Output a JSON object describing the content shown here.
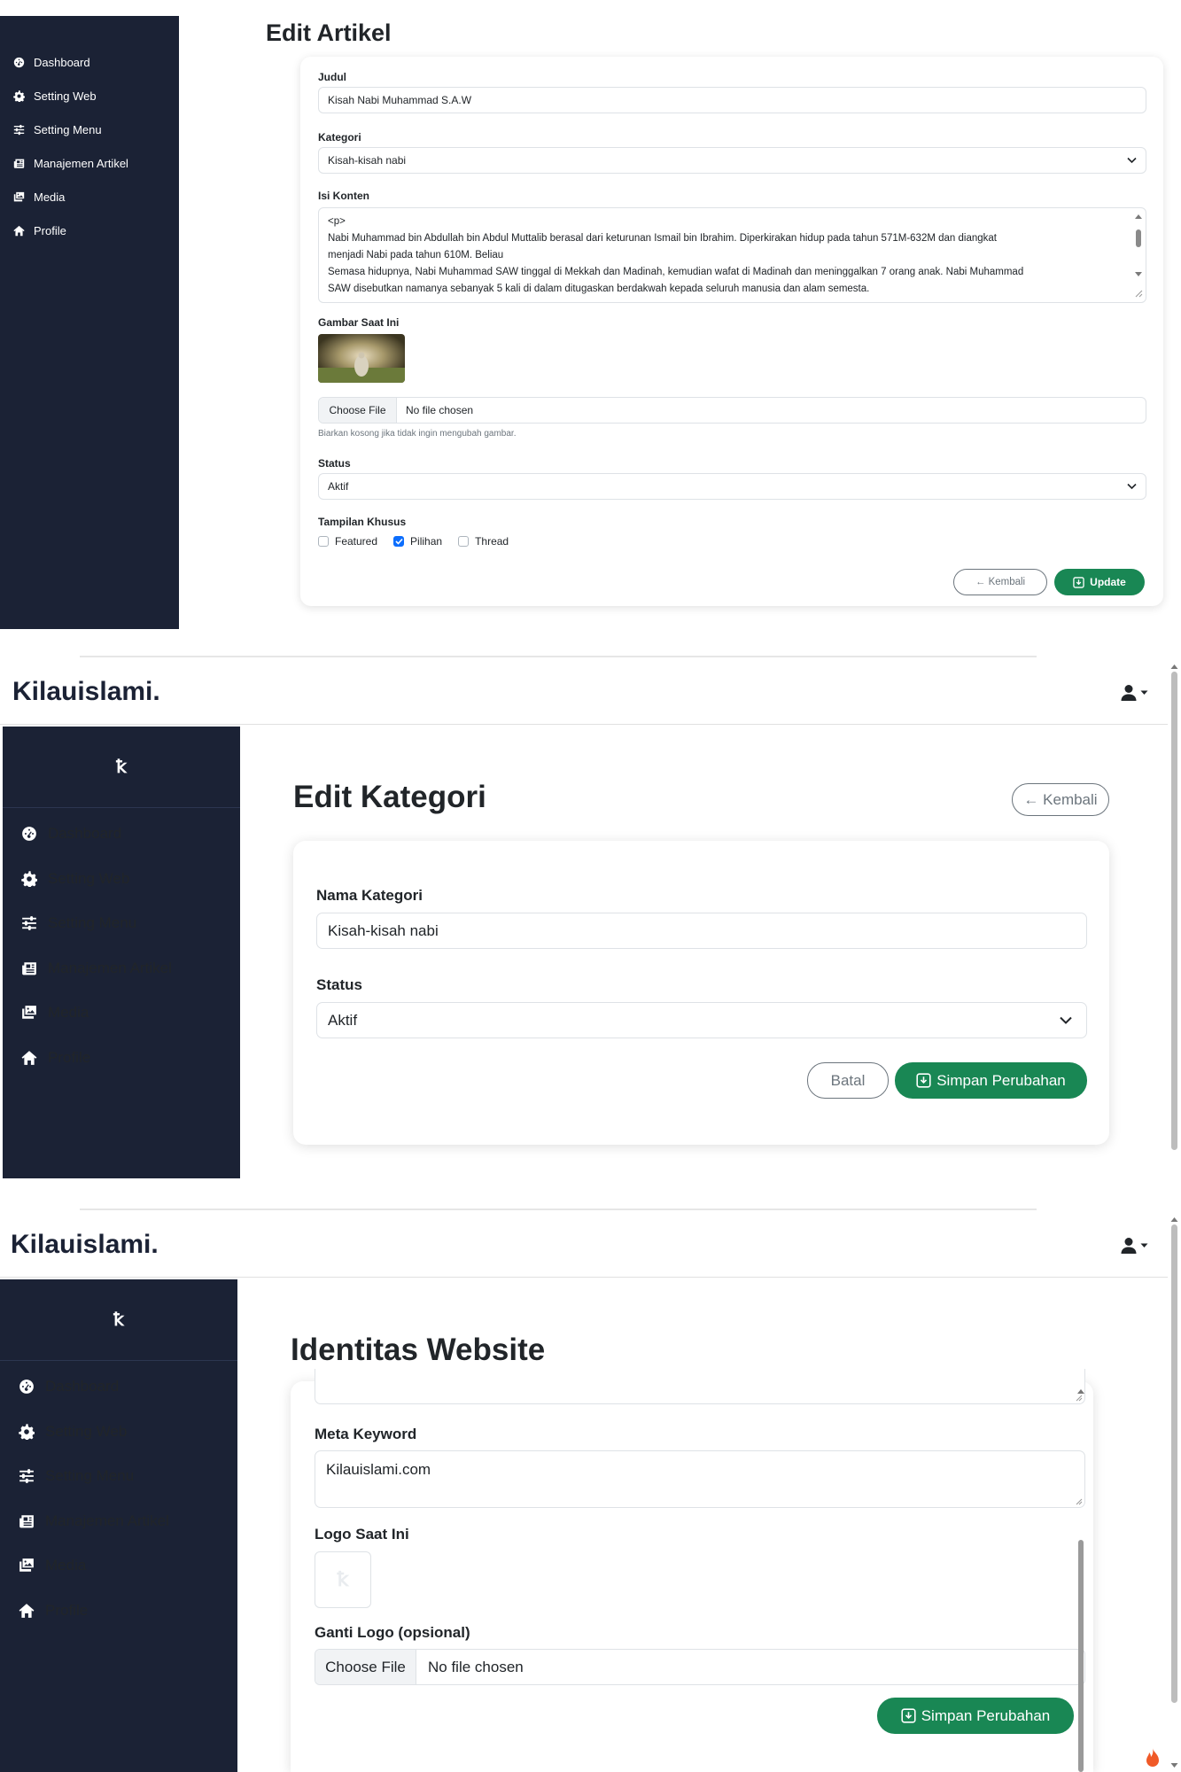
{
  "sidebar_items": [
    {
      "label": "Dashboard",
      "icon": "dashboard-icon"
    },
    {
      "label": "Setting Web",
      "icon": "gear-icon"
    },
    {
      "label": "Setting Menu",
      "icon": "sliders-icon"
    },
    {
      "label": "Manajemen Artikel",
      "icon": "newspaper-icon"
    },
    {
      "label": "Media",
      "icon": "images-icon"
    },
    {
      "label": "Profile",
      "icon": "home-icon"
    }
  ],
  "colors": {
    "sidebar_bg": "#1b2235",
    "accent_green": "#198754",
    "checkbox_blue": "#0d6efd"
  },
  "edit_artikel": {
    "title": "Edit Artikel",
    "judul_label": "Judul",
    "judul_value": "Kisah Nabi Muhammad S.A.W",
    "kategori_label": "Kategori",
    "kategori_value": "Kisah-kisah nabi",
    "konten_label": "Isi Konten",
    "konten_lines": [
      "<p>",
      "Nabi Muhammad bin Abdullah bin Abdul Muttalib berasal dari keturunan Ismail bin Ibrahim. Diperkirakan hidup pada tahun 571M-632M dan diangkat",
      "menjadi Nabi pada tahun 610M. Beliau",
      "Semasa hidupnya, Nabi Muhammad SAW tinggal di Mekkah dan Madinah, kemudian wafat di Madinah dan meninggalkan 7 orang anak. Nabi Muhammad",
      "SAW disebutkan namanya sebanyak 5 kali di dalam ditugaskan berdakwah kepada seluruh manusia dan alam semesta."
    ],
    "gambar_label": "Gambar Saat Ini",
    "file_button": "Choose File",
    "file_status": "No file chosen",
    "file_help": "Biarkan kosong jika tidak ingin mengubah gambar.",
    "status_label": "Status",
    "status_value": "Aktif",
    "tampilan_label": "Tampilan Khusus",
    "checkboxes": [
      {
        "label": "Featured",
        "checked": false
      },
      {
        "label": "Pilihan",
        "checked": true
      },
      {
        "label": "Thread",
        "checked": false
      }
    ],
    "back_button": "← Kembali",
    "update_button": "Update"
  },
  "brand": "Kilauislami.",
  "logo_glyph": "ꝁ",
  "edit_kategori": {
    "title": "Edit Kategori",
    "back_button": "← Kembali",
    "nama_label": "Nama Kategori",
    "nama_value": "Kisah-kisah nabi",
    "status_label": "Status",
    "status_value": "Aktif",
    "cancel_button": "Batal",
    "save_button": "Simpan Perubahan"
  },
  "identitas": {
    "title": "Identitas Website",
    "meta_keyword_label": "Meta Keyword",
    "meta_keyword_value": "Kilauislami.com",
    "logo_label": "Logo Saat Ini",
    "ganti_logo_label": "Ganti Logo (opsional)",
    "file_button": "Choose File",
    "file_status": "No file chosen",
    "save_button": "Simpan Perubahan"
  }
}
